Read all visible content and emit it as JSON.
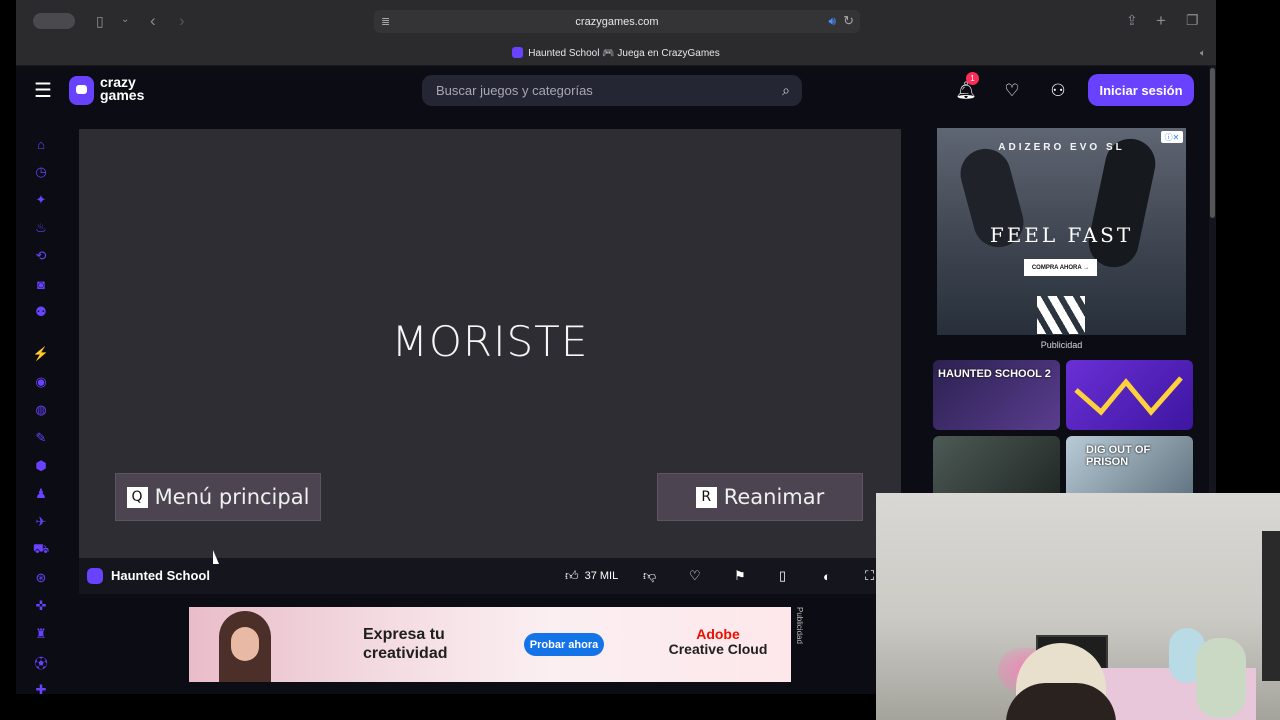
{
  "browser": {
    "url": "crazygames.com",
    "tab_title": "Haunted School 🎮 Juega en CrazyGames",
    "icons": [
      "sidebar-icon",
      "back-icon",
      "forward-icon",
      "share-icon",
      "new-tab-icon",
      "tabs-overview-icon"
    ]
  },
  "header": {
    "logo_line1": "crazy",
    "logo_line2": "games",
    "search_placeholder": "Buscar juegos y categorías",
    "notification_count": "1",
    "login_label": "Iniciar sesión"
  },
  "sidebar": {
    "items": [
      "home-icon",
      "recent-icon",
      "new-icon",
      "trending-icon",
      "updated-icon",
      "originals-icon",
      "multiplayer-icon",
      "action-icon",
      "adventure-icon",
      "basketball-icon",
      "beauty-icon",
      "bike-icon",
      "clicker-icon",
      "cooking-icon",
      "driving-icon",
      "racing-icon",
      "controller-icon",
      "chess-icon",
      "soccer-icon",
      "puzzle-icon"
    ]
  },
  "game": {
    "message": "MORISTE",
    "btn_menu_key": "Q",
    "btn_menu_label": "Menú principal",
    "btn_revive_key": "R",
    "btn_revive_label": "Reanimar",
    "title": "Haunted School",
    "likes": "37 MIL"
  },
  "bottom_ad": {
    "headline": "Expresa tu creatividad",
    "cta": "Probar ahora",
    "brand_line1": "Adobe",
    "brand_line2": "Creative Cloud",
    "side_label": "Publicidad"
  },
  "right_ad": {
    "top_text": "ADIZERO EVO SL",
    "main_text": "FEEL FAST",
    "cta": "COMPRA AHORA →",
    "label": "Publicidad"
  },
  "thumbnails": [
    {
      "title": "HAUNTED SCHOOL 2",
      "color": "#3b2a5e"
    },
    {
      "title": "",
      "color": "#5a2bb8"
    },
    {
      "title": "",
      "color": "#2f3a3a"
    },
    {
      "title": "DIG OUT OF PRISON",
      "color": "#7a8fa0"
    }
  ]
}
